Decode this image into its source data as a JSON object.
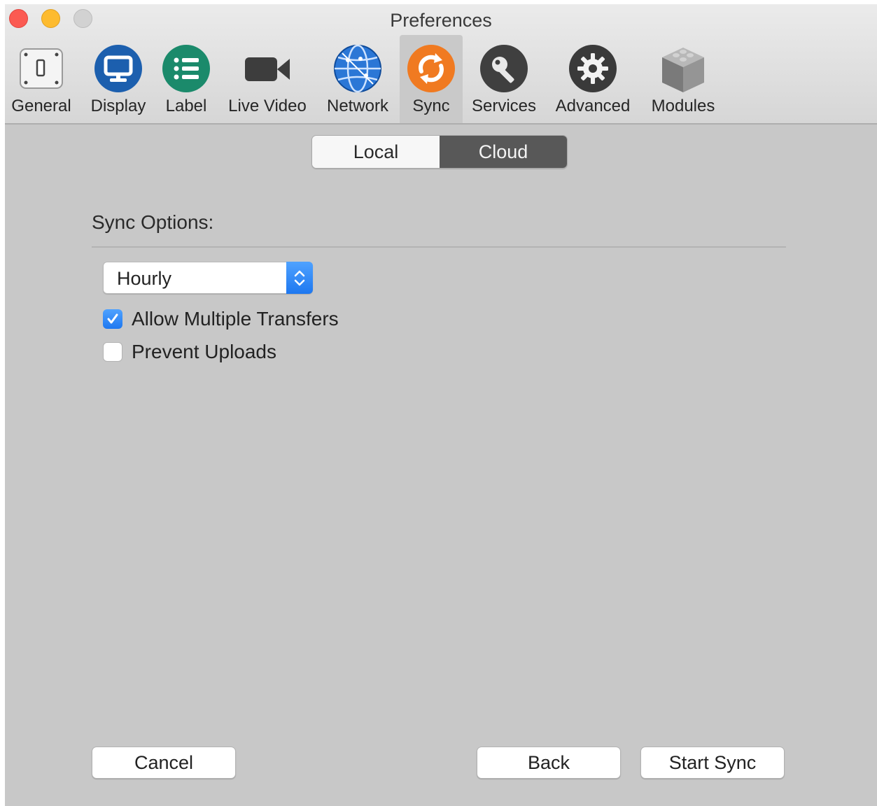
{
  "window": {
    "title": "Preferences"
  },
  "toolbar": {
    "items": [
      {
        "label": "General",
        "icon": "switch-icon"
      },
      {
        "label": "Display",
        "icon": "monitor-icon"
      },
      {
        "label": "Label",
        "icon": "list-icon"
      },
      {
        "label": "Live Video",
        "icon": "video-camera-icon"
      },
      {
        "label": "Network",
        "icon": "globe-icon"
      },
      {
        "label": "Sync",
        "icon": "sync-icon",
        "active": true
      },
      {
        "label": "Services",
        "icon": "key-icon"
      },
      {
        "label": "Advanced",
        "icon": "gear-icon"
      },
      {
        "label": "Modules",
        "icon": "cube-icon"
      }
    ]
  },
  "segmented": {
    "local_label": "Local",
    "cloud_label": "Cloud",
    "selected": "Cloud"
  },
  "sync_options": {
    "title": "Sync Options:",
    "frequency": {
      "value": "Hourly"
    },
    "allow_multiple_transfers": {
      "label": "Allow Multiple Transfers",
      "checked": true
    },
    "prevent_uploads": {
      "label": "Prevent Uploads",
      "checked": false
    }
  },
  "buttons": {
    "cancel": "Cancel",
    "back": "Back",
    "start_sync": "Start Sync"
  },
  "colors": {
    "accent": "#1e78f0",
    "sync_orange": "#f07a21",
    "display_blue": "#1c5fae",
    "label_green": "#1b8a6b"
  }
}
